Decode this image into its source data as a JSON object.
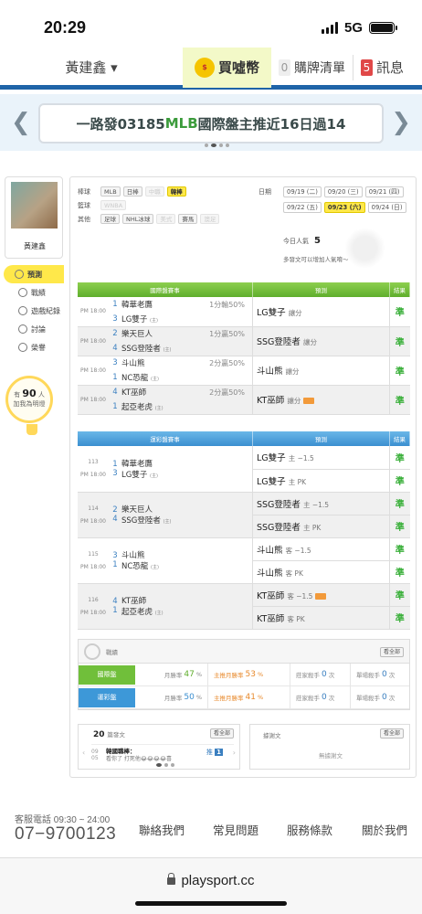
{
  "status": {
    "time": "20:29",
    "network": "5G"
  },
  "topnav": {
    "user": "黃建鑫 ▾",
    "coins_label": "買噓幣",
    "cart_count": "0",
    "cart_label": "購牌清單",
    "msg_count": "5",
    "msg_label": "訊息"
  },
  "banner": {
    "text_a": "一路發03185 ",
    "text_b": "MLB",
    "text_c": " 國際盤主推近16日過14"
  },
  "sidebar": {
    "username": "黃建鑫",
    "menu": [
      "預測",
      "戰績",
      "遊戲紀錄",
      "討論",
      "榮譽"
    ],
    "bulb_a": "有",
    "bulb_num": "90",
    "bulb_b": "人",
    "bulb_c": "加我為明燈"
  },
  "filters": {
    "row1_label": "棒球",
    "row1": [
      "MLB",
      "日棒",
      "中職",
      "韓棒"
    ],
    "row2_label": "籃球",
    "row2": [
      "WNBA"
    ],
    "row3_label": "其他",
    "row3": [
      "足球",
      "NHL冰球",
      "美式",
      "賽馬",
      "澳足"
    ]
  },
  "dates": {
    "label": "日期",
    "row1": [
      "09/19 (二)",
      "09/20 (三)",
      "09/21 (四)"
    ],
    "row2": [
      "09/22 (五)",
      "09/23 (六)",
      "09/24 (日)"
    ]
  },
  "popularity": {
    "label": "今日人氣",
    "value": "5",
    "hint": "多發文可以增加人氣唷～"
  },
  "intl": {
    "headers": [
      "國際盤賽事",
      "預測",
      "結果"
    ],
    "rows": [
      {
        "time": "PM 18:00",
        "n1": "1",
        "t1": "韓華老鷹",
        "n2": "3",
        "t2": "LG雙子",
        "home": "(主)",
        "line": "1分輸50%",
        "pred": "LG雙子",
        "sub": "讓分",
        "res": "準"
      },
      {
        "time": "PM 18:00",
        "n1": "2",
        "t1": "樂天巨人",
        "n2": "4",
        "t2": "SSG登陸者",
        "home": "(主)",
        "line": "1分贏50%",
        "pred": "SSG登陸者",
        "sub": "讓分",
        "res": "準"
      },
      {
        "time": "PM 18:00",
        "n1": "3",
        "t1": "斗山熊",
        "n2": "1",
        "t2": "NC恐龍",
        "home": "(主)",
        "line": "2分贏50%",
        "pred": "斗山熊",
        "sub": "讓分",
        "res": "準"
      },
      {
        "time": "PM 18:00",
        "n1": "4",
        "t1": "KT巫師",
        "n2": "1",
        "t2": "起亞老虎",
        "home": "(主)",
        "line": "2分贏50%",
        "pred": "KT巫師",
        "sub": "讓分",
        "res": "準"
      }
    ]
  },
  "lottery": {
    "headers": [
      "運彩盤賽事",
      "預測",
      "結果"
    ],
    "rows": [
      {
        "id": "113",
        "time": "PM 18:00",
        "n1": "1",
        "t1": "韓華老鷹",
        "n2": "3",
        "t2": "LG雙子",
        "home": "(主)",
        "p1": "LG雙子",
        "s1": "主 −1.5",
        "r1": "準",
        "p2": "LG雙子",
        "s2": "主 PK",
        "r2": "準"
      },
      {
        "id": "114",
        "time": "PM 18:00",
        "n1": "2",
        "t1": "樂天巨人",
        "n2": "4",
        "t2": "SSG登陸者",
        "home": "(主)",
        "p1": "SSG登陸者",
        "s1": "主 −1.5",
        "r1": "準",
        "p2": "SSG登陸者",
        "s2": "主 PK",
        "r2": "準"
      },
      {
        "id": "115",
        "time": "PM 18:00",
        "n1": "3",
        "t1": "斗山熊",
        "n2": "1",
        "t2": "NC恐龍",
        "home": "(主)",
        "p1": "斗山熊",
        "s1": "客 −1.5",
        "r1": "準",
        "p2": "斗山熊",
        "s2": "客 PK",
        "r2": "準"
      },
      {
        "id": "116",
        "time": "PM 18:00",
        "n1": "4",
        "t1": "KT巫師",
        "n2": "1",
        "t2": "起亞老虎",
        "home": "(主)",
        "p1": "KT巫師",
        "s1": "客 −1.5",
        "r1": "準",
        "p2": "KT巫師",
        "s2": "客 PK",
        "r2": "準"
      }
    ]
  },
  "record": {
    "title": "戰績",
    "see_all": "看全部",
    "rows": [
      {
        "label": "國際盤",
        "m1": "月勝率",
        "v1": "47",
        "u1": "%",
        "m2": "主推月勝率",
        "v2": "53",
        "u2": "%",
        "m3": "莊家殺手",
        "v3": "0",
        "u3": "次",
        "m4": "單場殺手",
        "v4": "0",
        "u4": "次"
      },
      {
        "label": "運彩盤",
        "m1": "月勝率",
        "v1": "50",
        "u1": "%",
        "m2": "主推月勝率",
        "v2": "41",
        "u2": "%",
        "m3": "莊家殺手",
        "v3": "0",
        "u3": "次",
        "m4": "單場殺手",
        "v4": "0",
        "u4": "次"
      }
    ]
  },
  "posts": {
    "count": "20",
    "label": "篇發文",
    "see_all": "看全部",
    "d1": "09",
    "d2": "05",
    "title": "韓國職棒：",
    "snippet": "看你了 打死他😂😂😂😂喜",
    "push_label": "推",
    "push_count": "1"
  },
  "replies": {
    "label": "據謝文",
    "see_all": "看全部",
    "empty": "無據謝文"
  },
  "footer": {
    "service": "客服電話 09:30 ~ 24:00",
    "tel": "07−9700123",
    "links": [
      "聯絡我們",
      "常見問題",
      "服務條款",
      "關於我們"
    ]
  },
  "urlbar": {
    "url": "playsport.cc"
  }
}
